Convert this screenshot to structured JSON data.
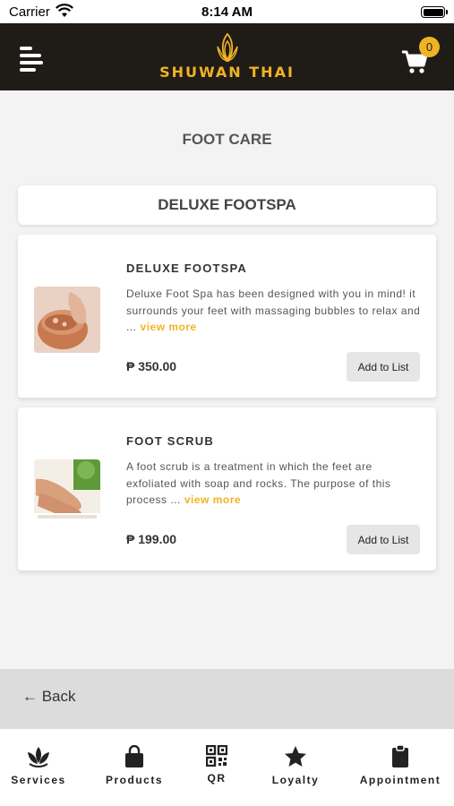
{
  "status_bar": {
    "carrier": "Carrier",
    "time": "8:14 AM"
  },
  "header": {
    "brand": "SHUWAN THAI",
    "cart_count": "0"
  },
  "page": {
    "title": "FOOT CARE",
    "section": "DELUXE FOOTSPA"
  },
  "products": [
    {
      "name": "DELUXE FOOTSPA",
      "description": "Deluxe Foot Spa has been designed with you in mind! it surrounds your feet with massaging bubbles to relax and ...",
      "view_more": "view more",
      "price": "₱ 350.00",
      "button": "Add to List"
    },
    {
      "name": "FOOT SCRUB",
      "description": "A foot scrub is a treatment in which the feet are exfoliated with soap and rocks. The purpose of this process ...",
      "view_more": "view more",
      "price": "₱ 199.00",
      "button": "Add to List"
    }
  ],
  "back": {
    "label": "← Back"
  },
  "tabs": [
    {
      "label": "Services",
      "icon": "lotus-icon"
    },
    {
      "label": "Products",
      "icon": "shopping-bag-icon"
    },
    {
      "label": "QR",
      "icon": "qr-code-icon"
    },
    {
      "label": "Loyalty",
      "icon": "star-icon"
    },
    {
      "label": "Appointment",
      "icon": "clipboard-icon"
    }
  ],
  "colors": {
    "header_bg": "#1f1b16",
    "accent": "#f0b323",
    "page_bg": "#f3f3f3"
  }
}
